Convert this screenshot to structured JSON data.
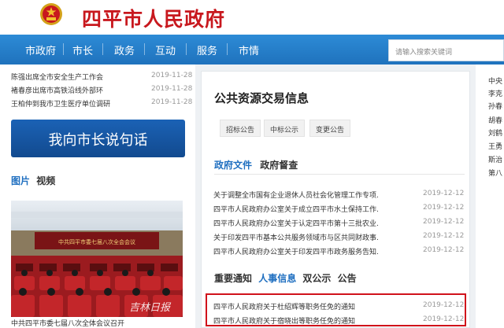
{
  "header": {
    "title": "四平市人民政府"
  },
  "nav": {
    "items": [
      "市政府",
      "市长",
      "政务",
      "互动",
      "服务",
      "市情"
    ],
    "search_placeholder": "请输入搜索关键词"
  },
  "left": {
    "news": [
      {
        "title": "陈强出席全市安全生产工作会",
        "date": "2019-11-28"
      },
      {
        "title": "褚春彦出席市高铁沿线外部环",
        "date": "2019-11-28"
      },
      {
        "title": "王柏仲到我市卫生医疗单位调研",
        "date": "2019-11-28"
      }
    ],
    "banner": "我向市长说句话",
    "tabs": [
      "图片",
      "视频"
    ],
    "photo_banner_text": "中共四平市委七届八次全会会议",
    "photo_caption": "中共四平市委七届八次全体会议召开",
    "photo_watermark": "吉林日报"
  },
  "middle": {
    "title": "公共资源交易信息",
    "pills": [
      "招标公告",
      "中标公示",
      "变更公告"
    ],
    "doc_tabs": [
      "政府文件",
      "政府督查"
    ],
    "documents": [
      {
        "title": "关于调整全市国有企业退休人员社会化管理工作专项...",
        "date": "2019-12-12"
      },
      {
        "title": "四平市人民政府办公室关于成立四平市水土保持工作...",
        "date": "2019-12-12"
      },
      {
        "title": "四平市人民政府办公室关于认定四平市第十三批农业...",
        "date": "2019-12-12"
      },
      {
        "title": "关于印发四平市基本公共服务领域市与区共同财政事...",
        "date": "2019-12-12"
      },
      {
        "title": "四平市人民政府办公室关于印发四平市政务服务告知...",
        "date": "2019-12-12"
      }
    ],
    "notice_tabs": [
      "重要通知",
      "人事信息",
      "双公示",
      "公告"
    ],
    "notices": [
      {
        "title": "四平市人民政府关于杜绍辉等职务任免的通知",
        "date": "2019-12-12"
      },
      {
        "title": "四平市人民政府关于宿晓出等职务任免的通知",
        "date": "2019-12-12"
      }
    ]
  },
  "right": {
    "items": [
      "中央",
      "李克",
      "孙春",
      "胡春",
      "刘鹤",
      "王勇",
      "斯治",
      "第八"
    ]
  },
  "colors": {
    "brand_red": "#c8181e",
    "nav_blue": "#2d8bd6",
    "link_blue": "#1f6fc0",
    "highlight_red": "#d0121b"
  }
}
